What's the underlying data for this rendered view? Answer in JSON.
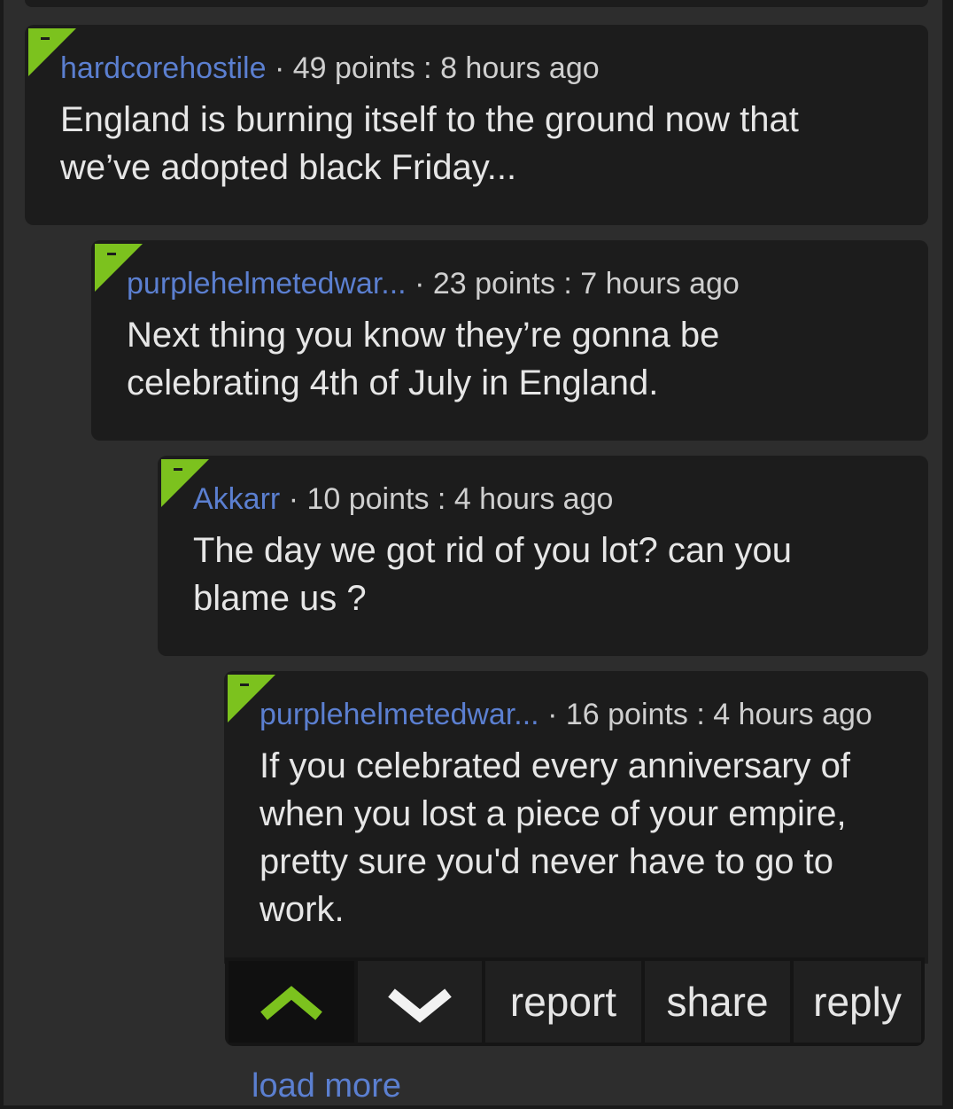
{
  "colors": {
    "background": "#2d2d2d",
    "card": "#1c1c1c",
    "author": "#5b7fd0",
    "accent_green": "#7cc21e",
    "text": "#e6e6e6",
    "meta": "#cfcfcf"
  },
  "comments": [
    {
      "author": "hardcorehostile",
      "separator": "·",
      "points": "49 points",
      "colon": ":",
      "time": "8 hours ago",
      "body": "England is burning itself to the ground now that we’ve adopted black Friday...",
      "flag_icon": "collapse-flag-icon"
    },
    {
      "author": "purplehelmetedwar...",
      "separator": "·",
      "points": "23 points",
      "colon": ":",
      "time": "7 hours ago",
      "body": "Next thing you know they’re gonna be celebrating 4th of July in England.",
      "flag_icon": "collapse-flag-icon"
    },
    {
      "author": "Akkarr",
      "separator": "·",
      "points": "10 points",
      "colon": ":",
      "time": "4 hours ago",
      "body": "The day we got rid of you lot? can you blame us ?",
      "flag_icon": "collapse-flag-icon"
    },
    {
      "author": "purplehelmetedwar...",
      "separator": "·",
      "points": "16 points",
      "colon": ":",
      "time": "4 hours ago",
      "body": "If you celebrated every anniversary of when you lost a piece of your empire, pretty sure you'd never have to go to work.",
      "flag_icon": "collapse-flag-icon"
    }
  ],
  "actions": {
    "upvote_icon": "upvote-chevron-icon",
    "downvote_icon": "downvote-chevron-icon",
    "report": "report",
    "share": "share",
    "reply": "reply",
    "upvoted": true
  },
  "load_more": "load more"
}
